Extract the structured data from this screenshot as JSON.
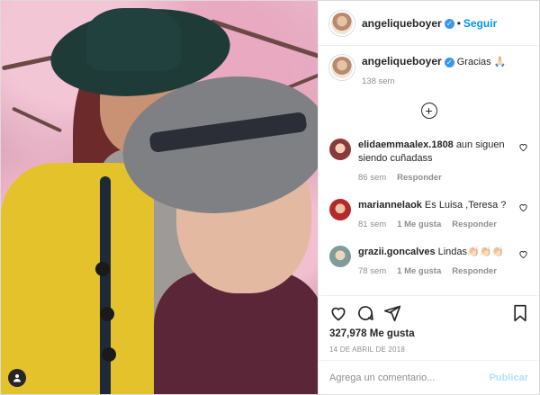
{
  "post": {
    "author": {
      "username": "angeliqueboyer",
      "verified_icon": "verified-badge-icon",
      "follow_label": "Seguir",
      "separator": "•"
    },
    "caption": {
      "username": "angeliqueboyer",
      "text": "Gracias 🙏🏻",
      "age": "138 sem"
    },
    "load_more_icon": "plus-circle-icon",
    "comments": [
      {
        "username": "elidaemmaalex.1808",
        "text": "aun siguen siendo cuñadass",
        "age": "86 sem",
        "likes": "",
        "reply_label": "Responder",
        "avatar_color": "#8a3a3a"
      },
      {
        "username": "mariannelaok",
        "text": "Es Luisa ,Teresa ?",
        "age": "81 sem",
        "likes": "1 Me gusta",
        "reply_label": "Responder",
        "avatar_color": "#b42a2a"
      },
      {
        "username": "grazii.goncalves",
        "text": "Lindas👏🏻👏🏻👏🏻",
        "age": "78 sem",
        "likes": "1 Me gusta",
        "reply_label": "Responder",
        "avatar_color": "#7d9c9a"
      }
    ],
    "actions": {
      "like_icon": "heart-icon",
      "comment_icon": "comment-icon",
      "share_icon": "paper-plane-icon",
      "save_icon": "bookmark-icon"
    },
    "likes_text": "327,978 Me gusta",
    "date": "14 de abril de 2018",
    "comment_box": {
      "placeholder": "Agrega un comentario...",
      "publish_label": "Publicar"
    }
  },
  "colors": {
    "accent": "#0095f6",
    "verified": "#3897f0",
    "muted": "#8e8e8e",
    "publish_disabled": "#b2dffc"
  }
}
